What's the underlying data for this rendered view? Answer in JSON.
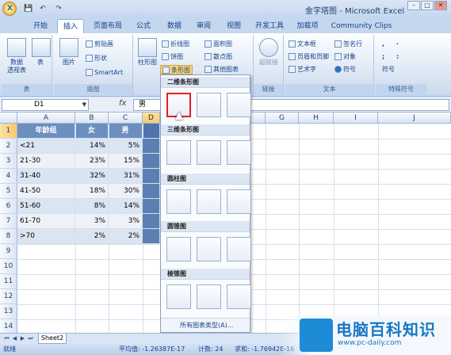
{
  "window": {
    "title": "金字塔图 - Microsoft Excel",
    "minimize": "–",
    "maximize": "□",
    "close": "✕"
  },
  "quick_access": {
    "save": "💾",
    "undo": "↶",
    "redo": "↷"
  },
  "tabs": [
    {
      "label": "开始"
    },
    {
      "label": "插入"
    },
    {
      "label": "页面布局"
    },
    {
      "label": "公式"
    },
    {
      "label": "数据"
    },
    {
      "label": "审阅"
    },
    {
      "label": "视图"
    },
    {
      "label": "开发工具"
    },
    {
      "label": "加载项"
    },
    {
      "label": "Community Clips"
    }
  ],
  "ribbon": {
    "pivot": {
      "label": "数据\n透视表",
      "group": "表"
    },
    "table": {
      "label": "表"
    },
    "picture": {
      "label": "图片"
    },
    "clipart": {
      "label": "剪贴画"
    },
    "shapes": {
      "label": "形状"
    },
    "smartart": {
      "label": "SmartArt"
    },
    "illus_group": "插图",
    "column": {
      "label": "柱形图"
    },
    "line": {
      "label": "折线图"
    },
    "pie": {
      "label": "饼图"
    },
    "bar": {
      "label": "条形图"
    },
    "area": {
      "label": "面积图"
    },
    "scatter": {
      "label": "散点图"
    },
    "other": {
      "label": "其他图表"
    },
    "hyperlink": {
      "label": "超链接",
      "group": "链接"
    },
    "textbox": {
      "label": "文本框"
    },
    "header": {
      "label": "页眉和页脚"
    },
    "wordart": {
      "label": "艺术字"
    },
    "signature": {
      "label": "签名行"
    },
    "object": {
      "label": "对象"
    },
    "symbol": {
      "label": "符号"
    },
    "text_group": "文本",
    "special_symbol": {
      "label": "符号"
    },
    "special_group": "特殊符号"
  },
  "formula_bar": {
    "name_box": "D1",
    "fx": "fx",
    "value": "男"
  },
  "columns": [
    "A",
    "B",
    "C",
    "D",
    "E",
    "F",
    "G",
    "H",
    "I",
    "J"
  ],
  "rows": [
    "1",
    "2",
    "3",
    "4",
    "5",
    "6",
    "7",
    "8",
    "9",
    "10",
    "11",
    "12",
    "13",
    "14"
  ],
  "table": {
    "headers": [
      "年龄组",
      "女",
      "男"
    ],
    "data": [
      [
        "<21",
        "14%",
        "5%"
      ],
      [
        "21-30",
        "23%",
        "15%"
      ],
      [
        "31-40",
        "32%",
        "31%"
      ],
      [
        "41-50",
        "18%",
        "30%"
      ],
      [
        "51-60",
        "8%",
        "14%"
      ],
      [
        "61-70",
        "3%",
        "3%"
      ],
      [
        ">70",
        "2%",
        "2%"
      ]
    ]
  },
  "dropdown": {
    "sections": [
      "二维条形图",
      "三维条形图",
      "圆柱图",
      "圆锥图",
      "棱锥图"
    ],
    "all_types": "所有图表类型(A)..."
  },
  "sheet": {
    "tab": "Sheet2"
  },
  "status": {
    "mode": "就绪",
    "average": "平均值: -1.26387E-17",
    "count": "计数: 24",
    "sum": "求和: -1.76942E-16"
  },
  "watermark": {
    "main": "电脑百科知识",
    "url": "www.pc-daily.com"
  }
}
